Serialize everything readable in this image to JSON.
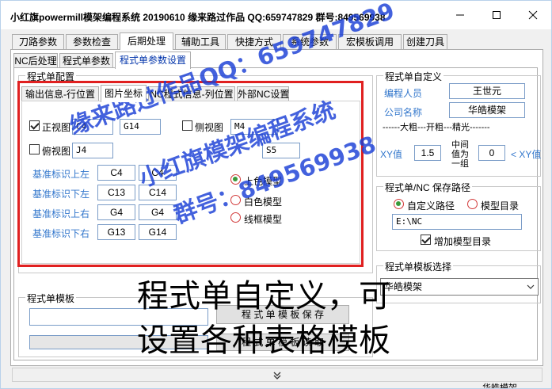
{
  "window": {
    "title": "小红旗powermill模架编程系统 20190610  缘来路过作品 QQ:659747829  群号:849569938",
    "colors": {
      "accent": "#0033aa",
      "label_blue": "#3377cc",
      "highlight_red": "#e02020",
      "watermark_blue": "#1a3fd6"
    }
  },
  "main_tabs": [
    "刀路参数",
    "参数检查",
    "后期处理",
    "辅助工具",
    "快捷方式",
    "系统参数",
    "宏模板调用",
    "创建刀具"
  ],
  "main_tab_active": "后期处理",
  "sub_tabs": [
    "NC后处理",
    "程式单参数",
    "程式单参数设置"
  ],
  "sub_tab_active": "程式单参数设置",
  "config_group": {
    "title": "程式单配置",
    "inner_tabs": [
      "输出信息-行位置",
      "图片坐标",
      "NC程式信息-列位置",
      "外部NC设置"
    ],
    "inner_tab_active": "图片坐标",
    "front_view": {
      "label": "正视图",
      "checked": true,
      "values": [
        "C4",
        "G14"
      ]
    },
    "side_view": {
      "label": "侧视图",
      "checked": false,
      "values": [
        "M4"
      ]
    },
    "top_view": {
      "label": "俯视图",
      "checked": false,
      "values": [
        "J4",
        "S5"
      ]
    },
    "base_marks": [
      {
        "label": "基准标识上左",
        "values": [
          "C4",
          "C4"
        ]
      },
      {
        "label": "基准标识下左",
        "values": [
          "C13",
          "C14"
        ]
      },
      {
        "label": "基准标识上右",
        "values": [
          "G4",
          "G4"
        ]
      },
      {
        "label": "基准标识下右",
        "values": [
          "G13",
          "G14"
        ]
      }
    ],
    "model_colors": [
      {
        "label": "上色模型",
        "selected": true
      },
      {
        "label": "白色模型",
        "selected": false
      },
      {
        "label": "线框模型",
        "selected": false
      }
    ]
  },
  "custom_group": {
    "title": "程式单自定义",
    "programmer_label": "编程人员",
    "programmer_value": "王世元",
    "company_label": "公司名称",
    "company_value": "华皓模架",
    "separator_text": "------大粗---开粗---精光-------",
    "xy_label": "XY值",
    "xy_value": "1.5",
    "middle_label": "中间值为一组",
    "middle_value": "0",
    "xy_right_label": "< XY值"
  },
  "save_path_group": {
    "title": "程式单/NC 保存路径",
    "options": [
      {
        "label": "自定义路径",
        "selected": true
      },
      {
        "label": "模型目录",
        "selected": false
      }
    ],
    "path_value": "E:\\NC",
    "add_model_dir_label": "增加模型目录",
    "add_model_dir_checked": true
  },
  "template_select_group": {
    "title": "程式单模板选择",
    "selected": "华皓模架"
  },
  "template_group": {
    "title": "程式单模板",
    "save_button": "程 式 单 模 板 保 存",
    "read_button": "程 式 单 模 板 读 取"
  },
  "expand_icon": "double-chevron-down-icon",
  "status_tail": "华皓模架",
  "watermarks": [
    "缘来路过作品QQ：659747829",
    "小红旗模架编程系统",
    "群号：849569938"
  ],
  "caption_lines": [
    "程式单自定义，可",
    "设置各种表格模板"
  ]
}
